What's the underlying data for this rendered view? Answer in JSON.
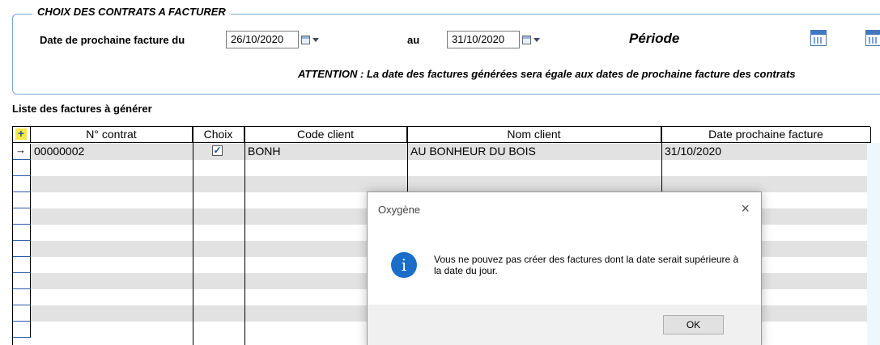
{
  "form": {
    "legend": "CHOIX DES CONTRATS A FACTURER",
    "date_label": "Date de prochaine facture du",
    "date_from": "26/10/2020",
    "au_label": "au",
    "date_to": "31/10/2020",
    "periode_label": "Période",
    "attention": "ATTENTION : La date des factures générées sera égale aux dates de prochaine facture des contrats"
  },
  "list": {
    "title": "Liste des factures à générer",
    "add_symbol": "+",
    "columns": [
      "N° contrat",
      "Choix",
      "Code client",
      "Nom client",
      "Date prochaine facture"
    ],
    "rows": [
      {
        "pointer": "→",
        "contrat": "00000002",
        "choix": true,
        "check_symbol": "✓",
        "code_client": "BONH",
        "nom_client": "AU BONHEUR DU BOIS",
        "date": "31/10/2020"
      }
    ]
  },
  "dialog": {
    "title": "Oxygène",
    "close": "×",
    "icon": "i",
    "message": "Vous ne pouvez pas créer des factures dont la date serait supérieure à la date du jour.",
    "ok_label": "OK"
  },
  "colors": {
    "info_blue": "#1a6ec8",
    "row_gray": "#e2e2e2",
    "fieldset_border": "#7fa6d6"
  }
}
